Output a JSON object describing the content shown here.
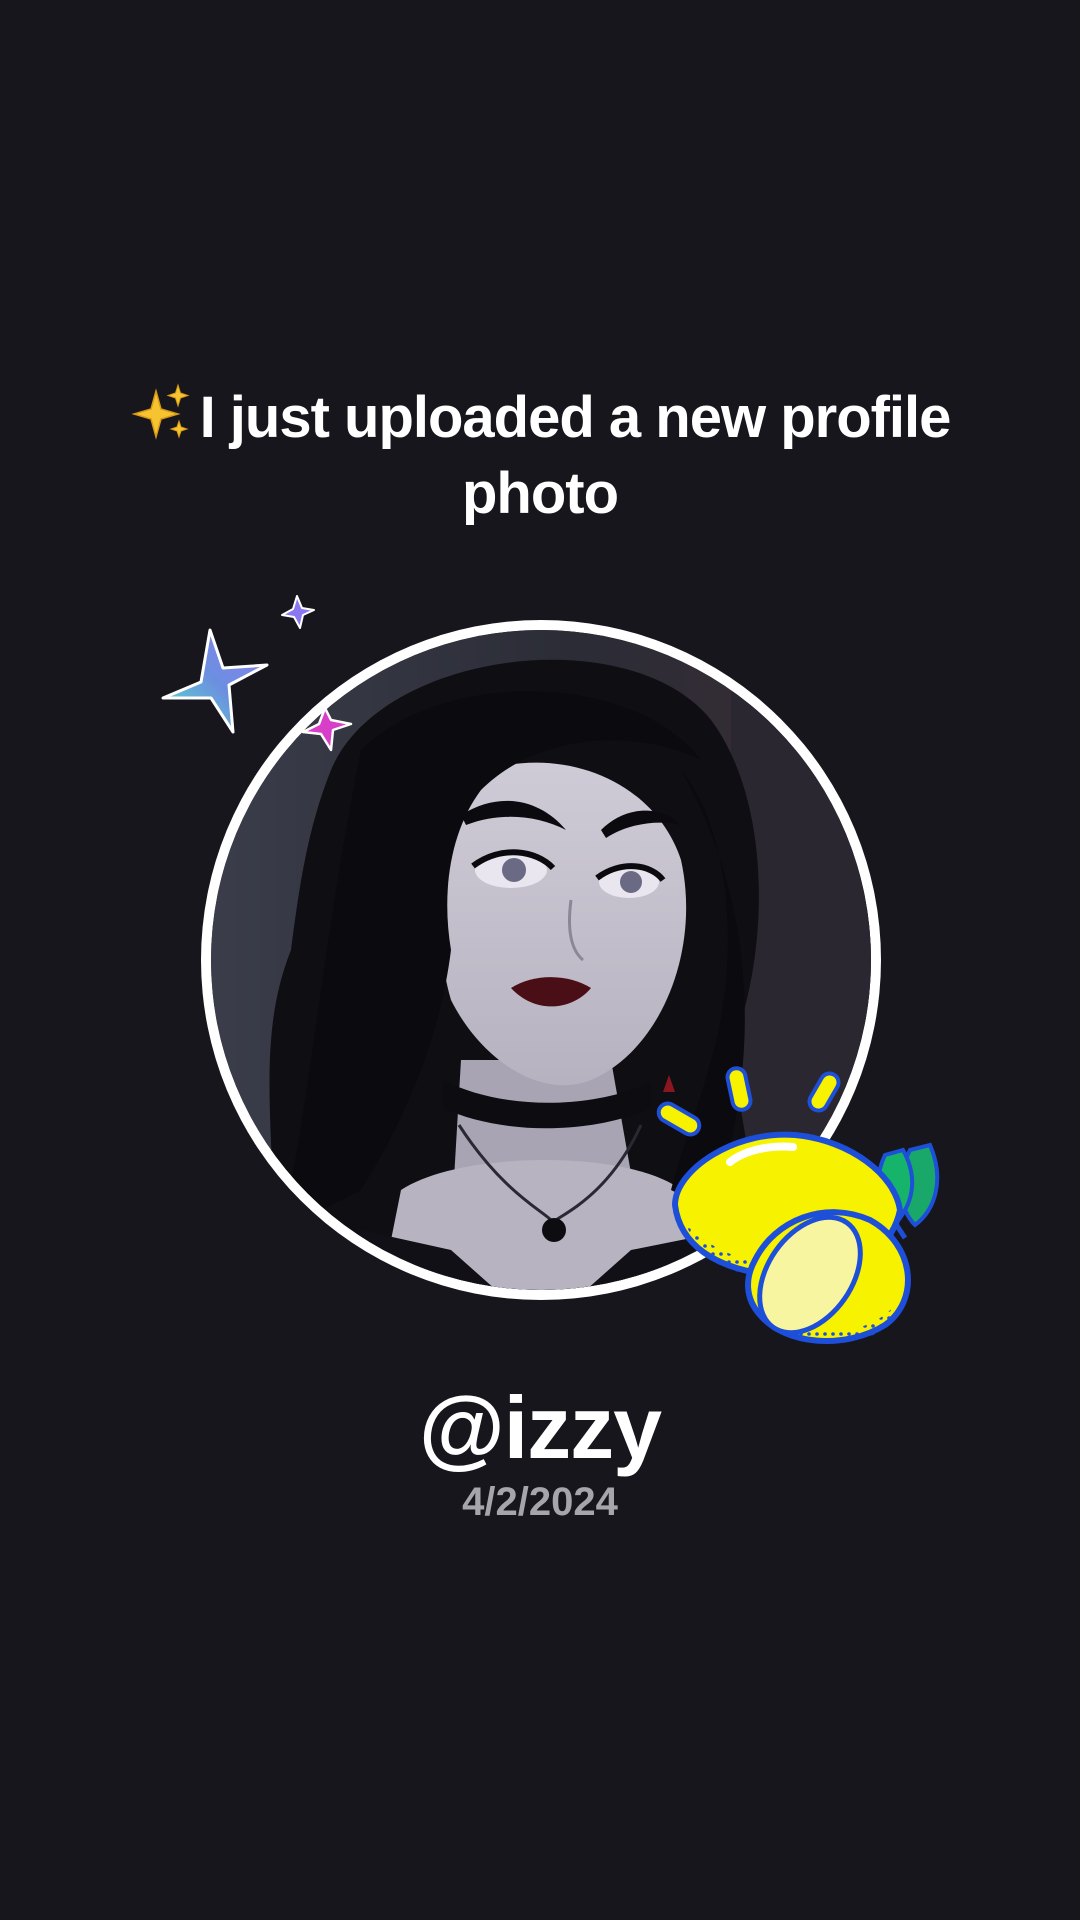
{
  "post": {
    "headline_emoji": "sparkles-icon",
    "headline": "I just uploaded a new profile photo",
    "username": "@izzy",
    "date": "4/2/2024"
  },
  "colors": {
    "background": "#17161d",
    "text_primary": "#ffffff",
    "text_secondary": "#a6a5ab",
    "avatar_ring": "#ffffff",
    "lemon_yellow": "#f6f200",
    "lemon_outline": "#1e4fd8",
    "leaf_green": "#16b46a"
  },
  "stickers": [
    "sparkle-star-sticker",
    "lemon-sticker"
  ]
}
